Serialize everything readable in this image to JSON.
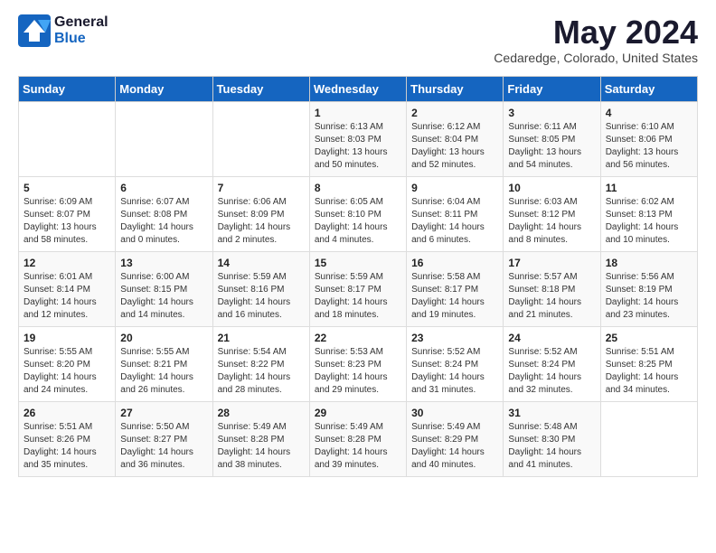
{
  "logo": {
    "general": "General",
    "blue": "Blue"
  },
  "title": {
    "month_year": "May 2024",
    "location": "Cedaredge, Colorado, United States"
  },
  "headers": [
    "Sunday",
    "Monday",
    "Tuesday",
    "Wednesday",
    "Thursday",
    "Friday",
    "Saturday"
  ],
  "weeks": [
    [
      {
        "day": "",
        "sunrise": "",
        "sunset": "",
        "daylight": ""
      },
      {
        "day": "",
        "sunrise": "",
        "sunset": "",
        "daylight": ""
      },
      {
        "day": "",
        "sunrise": "",
        "sunset": "",
        "daylight": ""
      },
      {
        "day": "1",
        "sunrise": "Sunrise: 6:13 AM",
        "sunset": "Sunset: 8:03 PM",
        "daylight": "Daylight: 13 hours and 50 minutes."
      },
      {
        "day": "2",
        "sunrise": "Sunrise: 6:12 AM",
        "sunset": "Sunset: 8:04 PM",
        "daylight": "Daylight: 13 hours and 52 minutes."
      },
      {
        "day": "3",
        "sunrise": "Sunrise: 6:11 AM",
        "sunset": "Sunset: 8:05 PM",
        "daylight": "Daylight: 13 hours and 54 minutes."
      },
      {
        "day": "4",
        "sunrise": "Sunrise: 6:10 AM",
        "sunset": "Sunset: 8:06 PM",
        "daylight": "Daylight: 13 hours and 56 minutes."
      }
    ],
    [
      {
        "day": "5",
        "sunrise": "Sunrise: 6:09 AM",
        "sunset": "Sunset: 8:07 PM",
        "daylight": "Daylight: 13 hours and 58 minutes."
      },
      {
        "day": "6",
        "sunrise": "Sunrise: 6:07 AM",
        "sunset": "Sunset: 8:08 PM",
        "daylight": "Daylight: 14 hours and 0 minutes."
      },
      {
        "day": "7",
        "sunrise": "Sunrise: 6:06 AM",
        "sunset": "Sunset: 8:09 PM",
        "daylight": "Daylight: 14 hours and 2 minutes."
      },
      {
        "day": "8",
        "sunrise": "Sunrise: 6:05 AM",
        "sunset": "Sunset: 8:10 PM",
        "daylight": "Daylight: 14 hours and 4 minutes."
      },
      {
        "day": "9",
        "sunrise": "Sunrise: 6:04 AM",
        "sunset": "Sunset: 8:11 PM",
        "daylight": "Daylight: 14 hours and 6 minutes."
      },
      {
        "day": "10",
        "sunrise": "Sunrise: 6:03 AM",
        "sunset": "Sunset: 8:12 PM",
        "daylight": "Daylight: 14 hours and 8 minutes."
      },
      {
        "day": "11",
        "sunrise": "Sunrise: 6:02 AM",
        "sunset": "Sunset: 8:13 PM",
        "daylight": "Daylight: 14 hours and 10 minutes."
      }
    ],
    [
      {
        "day": "12",
        "sunrise": "Sunrise: 6:01 AM",
        "sunset": "Sunset: 8:14 PM",
        "daylight": "Daylight: 14 hours and 12 minutes."
      },
      {
        "day": "13",
        "sunrise": "Sunrise: 6:00 AM",
        "sunset": "Sunset: 8:15 PM",
        "daylight": "Daylight: 14 hours and 14 minutes."
      },
      {
        "day": "14",
        "sunrise": "Sunrise: 5:59 AM",
        "sunset": "Sunset: 8:16 PM",
        "daylight": "Daylight: 14 hours and 16 minutes."
      },
      {
        "day": "15",
        "sunrise": "Sunrise: 5:59 AM",
        "sunset": "Sunset: 8:17 PM",
        "daylight": "Daylight: 14 hours and 18 minutes."
      },
      {
        "day": "16",
        "sunrise": "Sunrise: 5:58 AM",
        "sunset": "Sunset: 8:17 PM",
        "daylight": "Daylight: 14 hours and 19 minutes."
      },
      {
        "day": "17",
        "sunrise": "Sunrise: 5:57 AM",
        "sunset": "Sunset: 8:18 PM",
        "daylight": "Daylight: 14 hours and 21 minutes."
      },
      {
        "day": "18",
        "sunrise": "Sunrise: 5:56 AM",
        "sunset": "Sunset: 8:19 PM",
        "daylight": "Daylight: 14 hours and 23 minutes."
      }
    ],
    [
      {
        "day": "19",
        "sunrise": "Sunrise: 5:55 AM",
        "sunset": "Sunset: 8:20 PM",
        "daylight": "Daylight: 14 hours and 24 minutes."
      },
      {
        "day": "20",
        "sunrise": "Sunrise: 5:55 AM",
        "sunset": "Sunset: 8:21 PM",
        "daylight": "Daylight: 14 hours and 26 minutes."
      },
      {
        "day": "21",
        "sunrise": "Sunrise: 5:54 AM",
        "sunset": "Sunset: 8:22 PM",
        "daylight": "Daylight: 14 hours and 28 minutes."
      },
      {
        "day": "22",
        "sunrise": "Sunrise: 5:53 AM",
        "sunset": "Sunset: 8:23 PM",
        "daylight": "Daylight: 14 hours and 29 minutes."
      },
      {
        "day": "23",
        "sunrise": "Sunrise: 5:52 AM",
        "sunset": "Sunset: 8:24 PM",
        "daylight": "Daylight: 14 hours and 31 minutes."
      },
      {
        "day": "24",
        "sunrise": "Sunrise: 5:52 AM",
        "sunset": "Sunset: 8:24 PM",
        "daylight": "Daylight: 14 hours and 32 minutes."
      },
      {
        "day": "25",
        "sunrise": "Sunrise: 5:51 AM",
        "sunset": "Sunset: 8:25 PM",
        "daylight": "Daylight: 14 hours and 34 minutes."
      }
    ],
    [
      {
        "day": "26",
        "sunrise": "Sunrise: 5:51 AM",
        "sunset": "Sunset: 8:26 PM",
        "daylight": "Daylight: 14 hours and 35 minutes."
      },
      {
        "day": "27",
        "sunrise": "Sunrise: 5:50 AM",
        "sunset": "Sunset: 8:27 PM",
        "daylight": "Daylight: 14 hours and 36 minutes."
      },
      {
        "day": "28",
        "sunrise": "Sunrise: 5:49 AM",
        "sunset": "Sunset: 8:28 PM",
        "daylight": "Daylight: 14 hours and 38 minutes."
      },
      {
        "day": "29",
        "sunrise": "Sunrise: 5:49 AM",
        "sunset": "Sunset: 8:28 PM",
        "daylight": "Daylight: 14 hours and 39 minutes."
      },
      {
        "day": "30",
        "sunrise": "Sunrise: 5:49 AM",
        "sunset": "Sunset: 8:29 PM",
        "daylight": "Daylight: 14 hours and 40 minutes."
      },
      {
        "day": "31",
        "sunrise": "Sunrise: 5:48 AM",
        "sunset": "Sunset: 8:30 PM",
        "daylight": "Daylight: 14 hours and 41 minutes."
      },
      {
        "day": "",
        "sunrise": "",
        "sunset": "",
        "daylight": ""
      }
    ]
  ]
}
